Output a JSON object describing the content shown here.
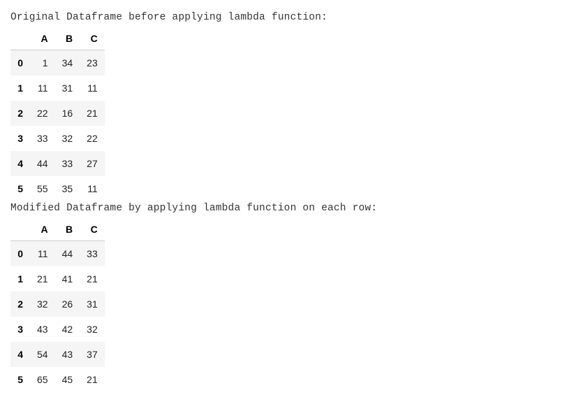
{
  "section1": {
    "caption": "Original Dataframe before applying lambda function:"
  },
  "section2": {
    "caption": "Modified Dataframe by applying lambda function on each row:"
  },
  "chart_data": [
    {
      "type": "table",
      "title": "Original Dataframe before applying lambda function:",
      "columns": [
        "A",
        "B",
        "C"
      ],
      "index": [
        "0",
        "1",
        "2",
        "3",
        "4",
        "5"
      ],
      "rows": [
        [
          1,
          34,
          23
        ],
        [
          11,
          31,
          11
        ],
        [
          22,
          16,
          21
        ],
        [
          33,
          32,
          22
        ],
        [
          44,
          33,
          27
        ],
        [
          55,
          35,
          11
        ]
      ]
    },
    {
      "type": "table",
      "title": "Modified Dataframe by applying lambda function on each row:",
      "columns": [
        "A",
        "B",
        "C"
      ],
      "index": [
        "0",
        "1",
        "2",
        "3",
        "4",
        "5"
      ],
      "rows": [
        [
          11,
          44,
          33
        ],
        [
          21,
          41,
          21
        ],
        [
          32,
          26,
          31
        ],
        [
          43,
          42,
          32
        ],
        [
          54,
          43,
          37
        ],
        [
          65,
          45,
          21
        ]
      ]
    }
  ]
}
